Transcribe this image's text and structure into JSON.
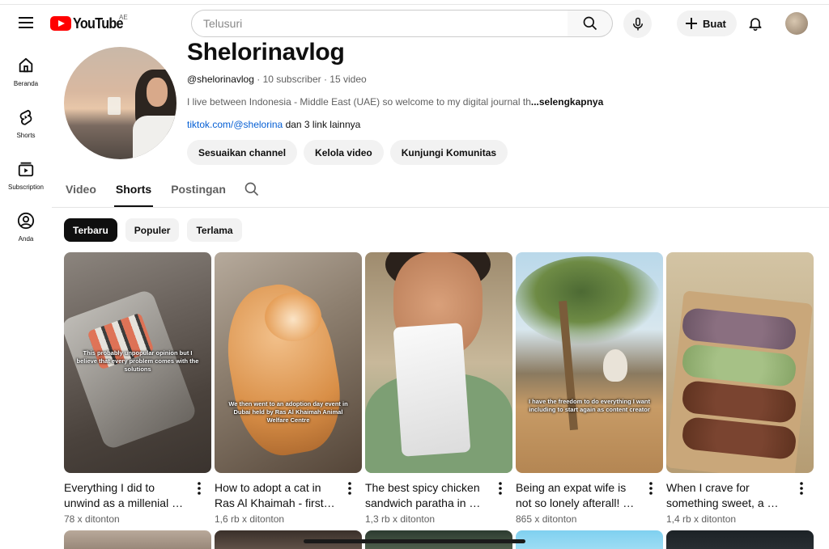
{
  "masthead": {
    "logo_text": "YouTube",
    "country_code": "AE",
    "search_placeholder": "Telusuri",
    "create_label": "Buat",
    "icons": [
      "menu-icon",
      "search-icon",
      "mic-icon",
      "plus-icon",
      "bell-icon"
    ]
  },
  "guide": {
    "items": [
      {
        "label": "Beranda",
        "icon": "home-icon"
      },
      {
        "label": "Shorts",
        "icon": "shorts-icon"
      },
      {
        "label": "Subscription",
        "icon": "subscriptions-icon"
      },
      {
        "label": "Anda",
        "icon": "you-icon"
      }
    ]
  },
  "channel": {
    "name": "Shelorinavlog",
    "handle": "@shelorinavlog",
    "subscribers": "10 subscriber",
    "videos": "15 video",
    "separator": " · ",
    "description": "I live between Indonesia - Middle East (UAE) so welcome to my digital journal th",
    "more_label": "...selengkapnya",
    "link_text": "tiktok.com/@shelorina",
    "link_more": " dan 3 link lainnya",
    "actions": [
      "Sesuaikan channel",
      "Kelola video",
      "Kunjungi Komunitas"
    ]
  },
  "tabs": {
    "items": [
      "Video",
      "Shorts",
      "Postingan"
    ],
    "active": "Shorts"
  },
  "chips": {
    "items": [
      "Terbaru",
      "Populer",
      "Terlama"
    ],
    "active": "Terbaru"
  },
  "shorts": [
    {
      "title": "Everything I did to unwind as a millenial …",
      "views": "78 x ditonton",
      "caption": "This probably unpopular opinion but I believe that every problem comes with the solutions"
    },
    {
      "title": "How to adopt a cat in Ras Al Khaimah - first …",
      "views": "1,6 rb x ditonton",
      "caption": "We then went to an adoption day event in Dubai held by Ras Al Khaimah Animal Welfare Centre"
    },
    {
      "title": "The best spicy chicken sandwich paratha in …",
      "views": "1,3 rb x ditonton",
      "caption": ""
    },
    {
      "title": "Being an expat wife is not so lonely afterall! …",
      "views": "865 x ditonton",
      "caption": "I have the freedom to do everything I want including to start again as content creator"
    },
    {
      "title": "When I crave for something sweet, a …",
      "views": "1,4 rb x ditonton",
      "caption": ""
    }
  ],
  "colors": {
    "brand_red": "#ff0000",
    "link_blue": "#065fd4",
    "chip_active": "#0f0f0f",
    "chip_bg": "#f2f2f2"
  }
}
